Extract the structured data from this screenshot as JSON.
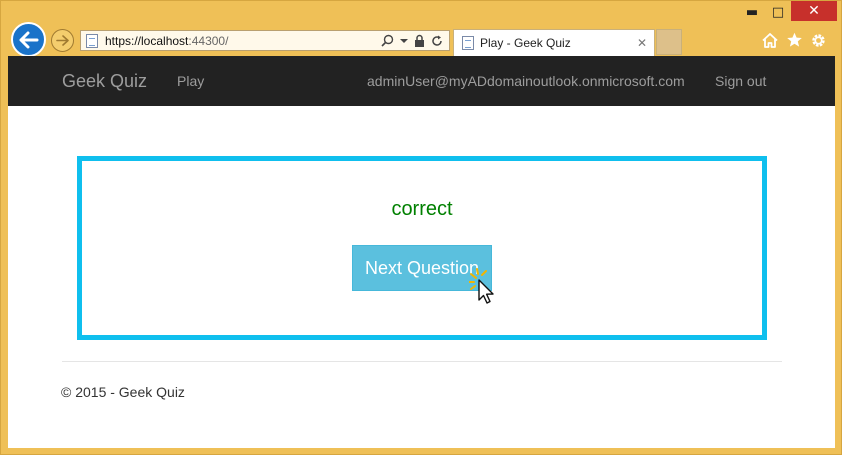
{
  "browser": {
    "window_controls": {
      "minimize": "▬",
      "maximize": "□",
      "close": "✕"
    },
    "address": {
      "url_prefix": "https://localhost",
      "url_port": ":44300/"
    },
    "tab": {
      "title": "Play - Geek Quiz",
      "close": "✕"
    },
    "colors": {
      "frame": "#efc057",
      "back_button": "#1a73c9"
    }
  },
  "navbar": {
    "brand": "Geek Quiz",
    "play": "Play",
    "user": "adminUser@myADdomainoutlook.onmicrosoft.com",
    "signout": "Sign out"
  },
  "quiz": {
    "result": "correct",
    "next_button": "Next Question",
    "colors": {
      "border": "#0fbfee",
      "result": "#008000",
      "button": "#5bc0de"
    }
  },
  "footer": {
    "text": "© 2015 - Geek Quiz"
  }
}
